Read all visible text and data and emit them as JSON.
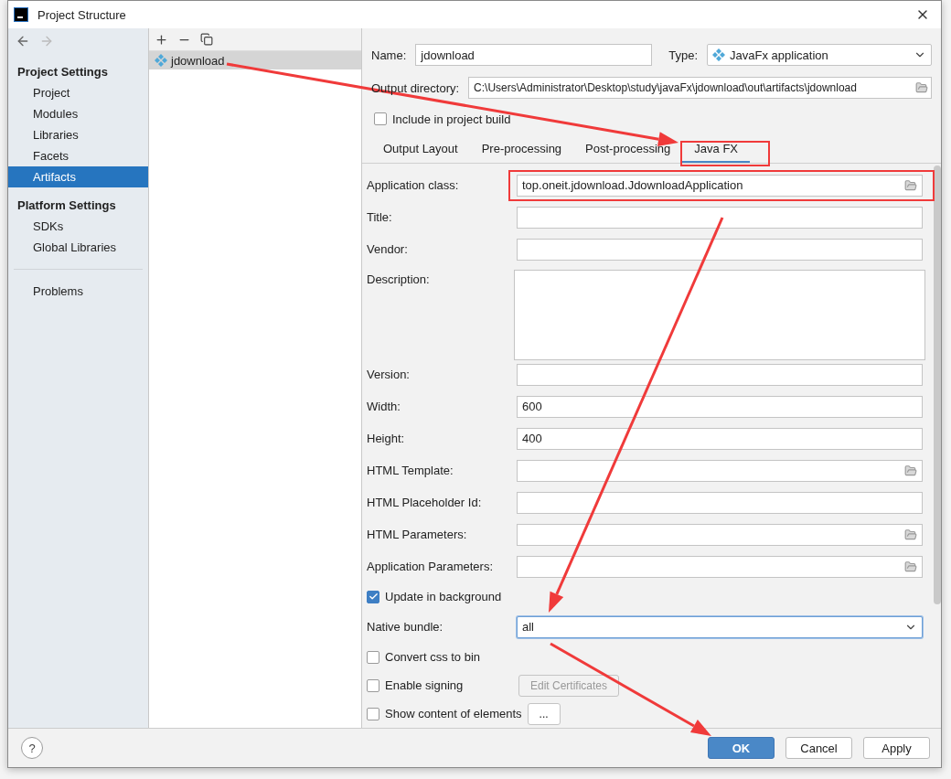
{
  "window": {
    "title": "Project Structure"
  },
  "sidebar": {
    "sections": [
      {
        "title": "Project Settings",
        "items": [
          {
            "label": "Project",
            "selected": false
          },
          {
            "label": "Modules",
            "selected": false
          },
          {
            "label": "Libraries",
            "selected": false
          },
          {
            "label": "Facets",
            "selected": false
          },
          {
            "label": "Artifacts",
            "selected": true
          }
        ]
      },
      {
        "title": "Platform Settings",
        "items": [
          {
            "label": "SDKs",
            "selected": false
          },
          {
            "label": "Global Libraries",
            "selected": false
          }
        ]
      },
      {
        "items": [
          {
            "label": "Problems",
            "selected": false
          }
        ]
      }
    ]
  },
  "artifacts": [
    {
      "name": "jdownload",
      "selected": true
    }
  ],
  "artifact": {
    "name_label": "Name:",
    "name": "jdownload",
    "type_label": "Type:",
    "type": "JavaFx application",
    "output_label": "Output directory:",
    "output": "C:\\Users\\Administrator\\Desktop\\study\\javaFx\\jdownload\\out\\artifacts\\jdownload",
    "include": {
      "label": "Include in project build",
      "checked": false
    }
  },
  "tabs": [
    {
      "label": "Output Layout",
      "selected": false
    },
    {
      "label": "Pre-processing",
      "selected": false
    },
    {
      "label": "Post-processing",
      "selected": false
    },
    {
      "label": "Java FX",
      "selected": true
    }
  ],
  "form": {
    "rows": [
      {
        "kind": "field",
        "label": "Application class:",
        "value": "top.oneit.jdownload.JdownloadApplication",
        "browse": true
      },
      {
        "kind": "field",
        "label": "Title:",
        "browse": false
      },
      {
        "kind": "field",
        "label": "Vendor:",
        "browse": false
      },
      {
        "kind": "area",
        "label": "Description:"
      },
      {
        "kind": "field",
        "label": "Version:",
        "browse": false
      },
      {
        "kind": "field",
        "label": "Width:",
        "value": "600",
        "browse": false
      },
      {
        "kind": "field",
        "label": "Height:",
        "value": "400",
        "browse": false
      },
      {
        "kind": "field",
        "label": "HTML Template:",
        "browse": true
      },
      {
        "kind": "field",
        "label": "HTML Placeholder Id:",
        "browse": false
      },
      {
        "kind": "field",
        "label": "HTML Parameters:",
        "browse": true
      },
      {
        "kind": "field",
        "label": "Application Parameters:",
        "browse": true
      },
      {
        "kind": "check",
        "label": "Update in background",
        "checked": true
      },
      {
        "kind": "select",
        "label": "Native bundle:",
        "value": "all"
      },
      {
        "kind": "check",
        "label": "Convert css to bin",
        "checked": false
      },
      {
        "kind": "check",
        "label": "Enable signing",
        "checked": false,
        "button": {
          "label": "Edit Certificates",
          "disabled": true
        }
      },
      {
        "kind": "check",
        "label": "Show content of elements",
        "checked": false,
        "button": {
          "label": "...",
          "disabled": false
        }
      }
    ]
  },
  "footer": {
    "help": "?",
    "buttons": [
      {
        "label": "OK",
        "primary": true
      },
      {
        "label": "Cancel",
        "primary": false
      },
      {
        "label": "Apply",
        "primary": false
      }
    ]
  }
}
